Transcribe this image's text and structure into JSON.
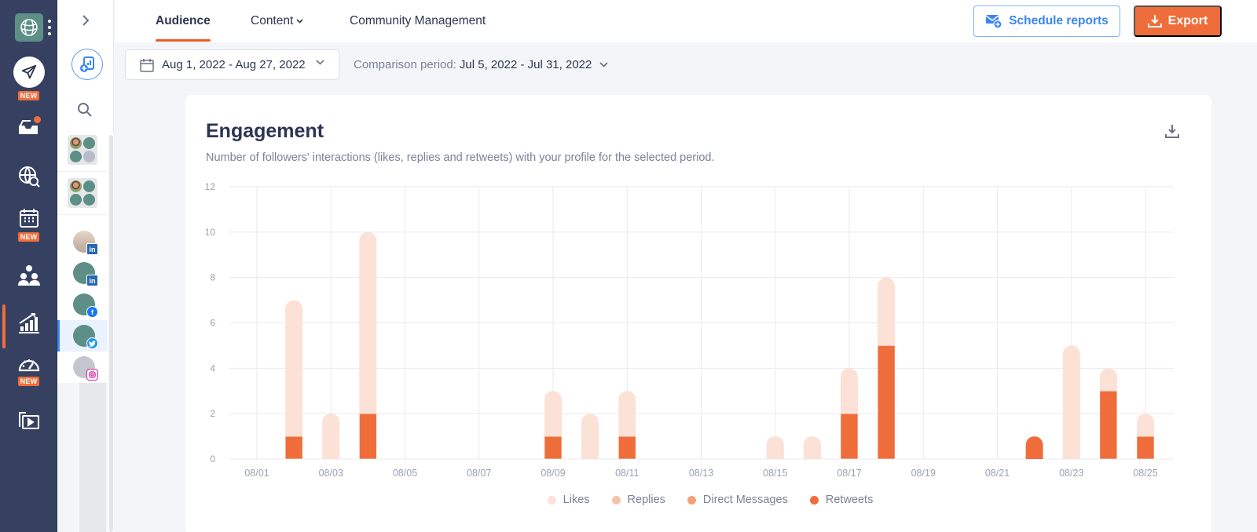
{
  "rail": {
    "logo_icon": "brand-logo-icon",
    "items": [
      {
        "name": "publish",
        "icon": "paper-plane-icon",
        "badge": "NEW"
      },
      {
        "name": "inbox",
        "icon": "inbox-icon",
        "has_notification_dot": true
      },
      {
        "name": "listening",
        "icon": "globe-search-icon"
      },
      {
        "name": "calendar",
        "icon": "calendar-icon",
        "badge": "NEW"
      },
      {
        "name": "audience",
        "icon": "users-icon"
      },
      {
        "name": "analytics",
        "icon": "chart-trend-icon",
        "active": true
      },
      {
        "name": "dashboard",
        "icon": "speedometer-icon",
        "badge": "NEW"
      },
      {
        "name": "media-library",
        "icon": "media-folder-icon"
      }
    ]
  },
  "sidebar": {
    "expand_icon": "chevron-right-icon",
    "add_report_icon": "add-report-icon",
    "search_icon": "search-icon",
    "groups": [
      {
        "name": "profile-group-1"
      },
      {
        "name": "profile-group-2"
      }
    ],
    "profiles": [
      {
        "network": "linkedin",
        "badge": "in",
        "avatar": "photo"
      },
      {
        "network": "linkedin",
        "badge": "in",
        "avatar": "brand"
      },
      {
        "network": "facebook",
        "badge": "f",
        "avatar": "brand"
      },
      {
        "network": "twitter",
        "badge": "t",
        "avatar": "brand",
        "active": true
      },
      {
        "network": "instagram",
        "badge": "ig",
        "avatar": "gray"
      }
    ]
  },
  "topbar": {
    "tabs": [
      {
        "label": "Audience",
        "active": true
      },
      {
        "label": "Content",
        "has_dropdown": true
      },
      {
        "label": "Community Management"
      }
    ],
    "schedule_reports_label": "Schedule reports",
    "export_label": "Export"
  },
  "filters": {
    "date_range": "Aug 1, 2022 - Aug 27, 2022",
    "comparison_label": "Comparison period:",
    "comparison_value": "Jul 5, 2022 - Jul 31, 2022"
  },
  "card": {
    "title": "Engagement",
    "subtitle": "Number of followers' interactions (likes, replies and retweets) with your profile for the selected period."
  },
  "colors": {
    "accent": "#ee6d3a",
    "likes": "#fbe1d6",
    "replies": "#f6c2a8",
    "direct_messages": "#f2a07a",
    "retweets": "#ee6d3a",
    "primary_blue": "#3a86f0",
    "rail_bg": "#364161"
  },
  "chart_data": {
    "type": "bar",
    "stacked": true,
    "title": "Engagement",
    "xlabel": "",
    "ylabel": "",
    "ylim": [
      0,
      12
    ],
    "yticks": [
      0,
      2,
      4,
      6,
      8,
      10,
      12
    ],
    "xticks": [
      "08/01",
      "08/03",
      "08/05",
      "08/07",
      "08/09",
      "08/11",
      "08/13",
      "08/15",
      "08/17",
      "08/19",
      "08/21",
      "08/23",
      "08/25"
    ],
    "grid": true,
    "legend_position": "bottom",
    "categories": [
      "08/01",
      "08/02",
      "08/03",
      "08/04",
      "08/05",
      "08/06",
      "08/07",
      "08/08",
      "08/09",
      "08/10",
      "08/11",
      "08/12",
      "08/13",
      "08/14",
      "08/15",
      "08/16",
      "08/17",
      "08/18",
      "08/19",
      "08/20",
      "08/21",
      "08/22",
      "08/23",
      "08/24",
      "08/25"
    ],
    "series": [
      {
        "name": "Retweets",
        "color": "#ee6d3a",
        "values": [
          0,
          1,
          0,
          2,
          0,
          0,
          0,
          0,
          1,
          0,
          1,
          0,
          0,
          0,
          0,
          0,
          2,
          5,
          0,
          0,
          0,
          1,
          0,
          3,
          1
        ]
      },
      {
        "name": "Direct Messages",
        "color": "#f2a07a",
        "values": [
          0,
          0,
          0,
          0,
          0,
          0,
          0,
          0,
          0,
          0,
          0,
          0,
          0,
          0,
          0,
          0,
          0,
          0,
          0,
          0,
          0,
          0,
          0,
          0,
          0
        ]
      },
      {
        "name": "Replies",
        "color": "#f6c2a8",
        "values": [
          0,
          0,
          0,
          0,
          0,
          0,
          0,
          0,
          0,
          0,
          0,
          0,
          0,
          0,
          0,
          0,
          0,
          0,
          0,
          0,
          0,
          0,
          0,
          0,
          0
        ]
      },
      {
        "name": "Likes",
        "color": "#fbe1d6",
        "values": [
          0,
          6,
          2,
          8,
          0,
          0,
          0,
          0,
          2,
          2,
          2,
          0,
          0,
          0,
          1,
          1,
          2,
          3,
          0,
          0,
          0,
          0,
          5,
          1,
          1
        ]
      }
    ],
    "legend": [
      "Likes",
      "Replies",
      "Direct Messages",
      "Retweets"
    ]
  }
}
